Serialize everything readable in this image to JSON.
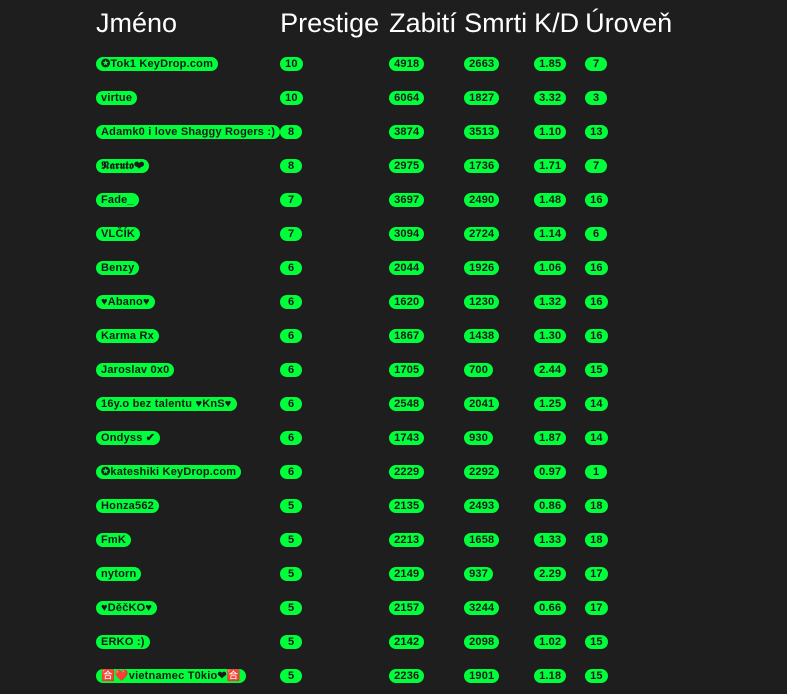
{
  "headers": {
    "name": "Jméno",
    "prestige": "Prestige",
    "kills": "Zabití",
    "deaths": "Smrti",
    "kd": "K/D",
    "level": "Úroveň"
  },
  "rows": [
    {
      "name": "✪Tok1 KeyDrop.com",
      "prestige": "10",
      "kills": "4918",
      "deaths": "2663",
      "kd": "1.85",
      "level": "7"
    },
    {
      "name": "virtue",
      "prestige": "10",
      "kills": "6064",
      "deaths": "1827",
      "kd": "3.32",
      "level": "3"
    },
    {
      "name": "Adamk0 i love Shaggy Rogers :)",
      "prestige": "8",
      "kills": "3874",
      "deaths": "3513",
      "kd": "1.10",
      "level": "13"
    },
    {
      "name": "𝕹𝖆𝖗𝖚𝖙𝖔❤",
      "prestige": "8",
      "kills": "2975",
      "deaths": "1736",
      "kd": "1.71",
      "level": "7"
    },
    {
      "name": "Fade_",
      "prestige": "7",
      "kills": "3697",
      "deaths": "2490",
      "kd": "1.48",
      "level": "16"
    },
    {
      "name": "VLČÍK",
      "prestige": "7",
      "kills": "3094",
      "deaths": "2724",
      "kd": "1.14",
      "level": "6"
    },
    {
      "name": "Benzy",
      "prestige": "6",
      "kills": "2044",
      "deaths": "1926",
      "kd": "1.06",
      "level": "16"
    },
    {
      "name": "♥Abano♥",
      "prestige": "6",
      "kills": "1620",
      "deaths": "1230",
      "kd": "1.32",
      "level": "16"
    },
    {
      "name": "Karma Rx",
      "prestige": "6",
      "kills": "1867",
      "deaths": "1438",
      "kd": "1.30",
      "level": "16"
    },
    {
      "name": "Jaroslav 0x0",
      "prestige": "6",
      "kills": "1705",
      "deaths": "700",
      "kd": "2.44",
      "level": "15"
    },
    {
      "name": "16y.o bez talentu ♥KnS♥",
      "prestige": "6",
      "kills": "2548",
      "deaths": "2041",
      "kd": "1.25",
      "level": "14"
    },
    {
      "name": "Ondyss ✔",
      "prestige": "6",
      "kills": "1743",
      "deaths": "930",
      "kd": "1.87",
      "level": "14"
    },
    {
      "name": "✪kateshiki KeyDrop.com",
      "prestige": "6",
      "kills": "2229",
      "deaths": "2292",
      "kd": "0.97",
      "level": "1"
    },
    {
      "name": "Honza562",
      "prestige": "5",
      "kills": "2135",
      "deaths": "2493",
      "kd": "0.86",
      "level": "18"
    },
    {
      "name": "FmK",
      "prestige": "5",
      "kills": "2213",
      "deaths": "1658",
      "kd": "1.33",
      "level": "18"
    },
    {
      "name": "nytorn",
      "prestige": "5",
      "kills": "2149",
      "deaths": "937",
      "kd": "2.29",
      "level": "17"
    },
    {
      "name": "♥DěčKO♥",
      "prestige": "5",
      "kills": "2157",
      "deaths": "3244",
      "kd": "0.66",
      "level": "17"
    },
    {
      "name": "ERKO :)",
      "prestige": "5",
      "kills": "2142",
      "deaths": "2098",
      "kd": "1.02",
      "level": "15"
    },
    {
      "name": "🈴❤️vietnamec T0kio❤🈴",
      "prestige": "5",
      "kills": "2236",
      "deaths": "1901",
      "kd": "1.18",
      "level": "15"
    }
  ]
}
